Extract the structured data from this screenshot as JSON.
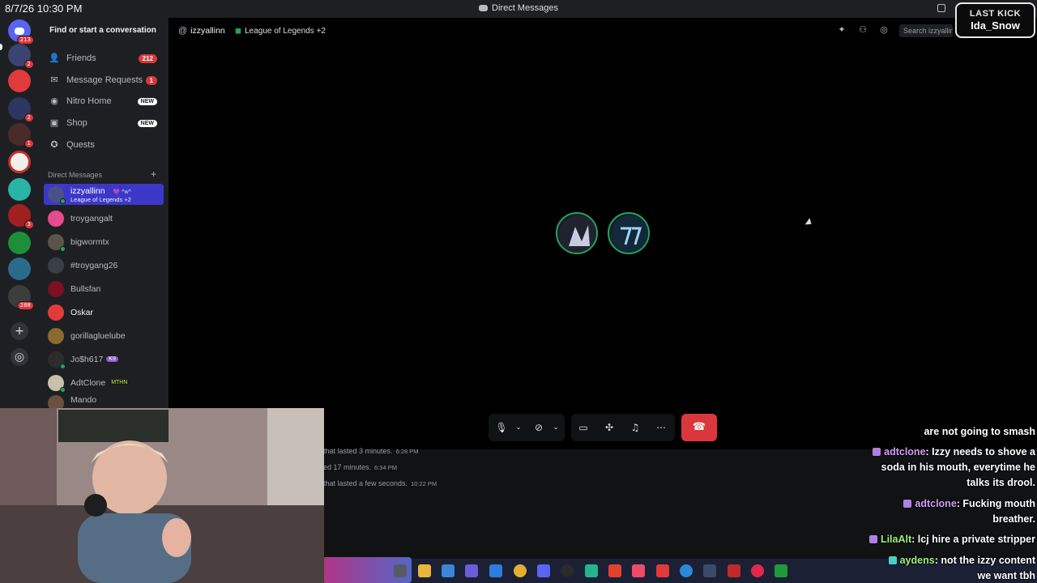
{
  "topbar": {
    "datetime": "8/7/26 10:30 PM",
    "window_title": "Direct Messages"
  },
  "overlay": {
    "last_kick_label": "LAST KICK",
    "last_kick_user": "Ida_Snow"
  },
  "rail": {
    "badges": [
      "213",
      "2",
      "",
      "2",
      "1",
      "",
      "",
      "3",
      "",
      "",
      "288"
    ]
  },
  "sidebar": {
    "search_label": "Find or start a conversation",
    "nav": [
      {
        "label": "Friends",
        "icon": "friends-icon",
        "count": "212"
      },
      {
        "label": "Message Requests",
        "icon": "envelope-icon",
        "count": "1"
      },
      {
        "label": "Nitro Home",
        "icon": "nitro-icon",
        "tag": "NEW"
      },
      {
        "label": "Shop",
        "icon": "shop-icon",
        "tag": "NEW"
      },
      {
        "label": "Quests",
        "icon": "quests-icon"
      }
    ],
    "dm_header": "Direct Messages",
    "dms": [
      {
        "name": "izzyallinn",
        "tag": "💜 ^w^",
        "sub": "League of Legends +2",
        "selected": true,
        "color": "#4a4f8a"
      },
      {
        "name": "troygangalt",
        "color": "#e64b8d"
      },
      {
        "name": "bigwormtx",
        "color": "#5b5448"
      },
      {
        "name": "#troygang26",
        "color": "#3a3f46"
      },
      {
        "name": "Bullsfan",
        "color": "#7a1020"
      },
      {
        "name": "Oskar",
        "color": "#e03a3a"
      },
      {
        "name": "gorillagluelube",
        "color": "#8a6a30"
      },
      {
        "name": "Jo$h617",
        "tag": "K9",
        "color": "#2c2c2c"
      },
      {
        "name": "AdtClone",
        "tag": "MTHN",
        "color": "#c8c0a8"
      },
      {
        "name": "Mando",
        "color": "#6a5040"
      }
    ]
  },
  "call": {
    "user": "izzyallinn",
    "activity": "League of Legends +2",
    "search_placeholder": "Search izzyallinn"
  },
  "messages": [
    {
      "text": "that lasted 3 minutes.",
      "time": "6:28 PM"
    },
    {
      "text": "ed 17 minutes.",
      "time": "6:34 PM"
    },
    {
      "text": "that lasted a few seconds.",
      "time": "10:22 PM"
    }
  ],
  "stream_chat": [
    {
      "user": "",
      "text": "are not going to smash"
    },
    {
      "user": "adtclone",
      "text": ": Izzy needs to shove a"
    },
    {
      "user": "",
      "text": "soda in his mouth, everytime he"
    },
    {
      "user": "",
      "text": "talks its drool."
    },
    {
      "user": "adtclone",
      "text": ": Fucking mouth"
    },
    {
      "user": "",
      "text": "breather."
    },
    {
      "user": "LilaAlt",
      "text": ": lcj hire a private stripper"
    },
    {
      "user": "aydens",
      "text": ": not the izzy content"
    },
    {
      "user": "",
      "text": "we want tbh"
    }
  ],
  "colors": {
    "accent": "#5865f2",
    "selected_dm": "#3b38c9",
    "online": "#23a55a",
    "danger": "#da373c"
  }
}
